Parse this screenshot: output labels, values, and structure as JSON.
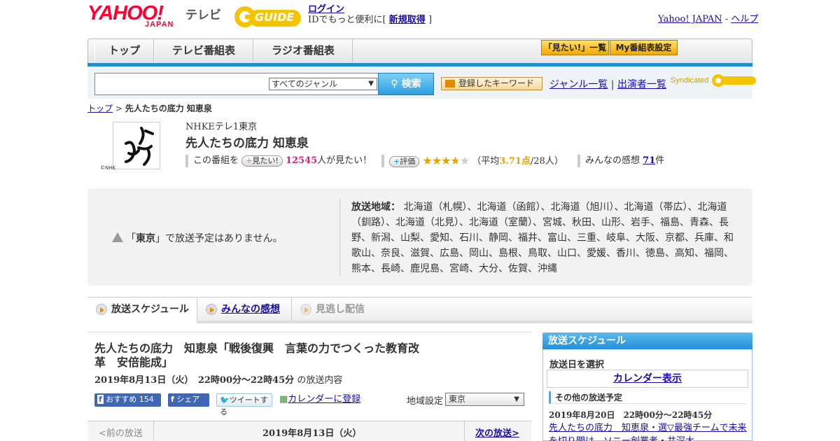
{
  "header": {
    "logo_yahoo": "YAHOO!",
    "logo_japan": "JAPAN",
    "tv_label": "テレビ",
    "gguide_label": "GUIDE",
    "login_link": "ログイン",
    "login_prefix": "IDでもっと便利に[",
    "register_link": "新規取得",
    "login_suffix": "]",
    "yahoo_japan_link": "Yahoo! JAPAN",
    "separator": "-",
    "help_link": "ヘルプ"
  },
  "nav": {
    "tabs": [
      "トップ",
      "テレビ番組表",
      "ラジオ番組表"
    ],
    "want_list_btn": "「見たい!」一覧",
    "my_program_btn": "My番組表設定"
  },
  "search": {
    "genre_select": "すべてのジャンル",
    "search_btn": "検索",
    "keyword_btn": "登録したキーワード",
    "genre_list_link": "ジャンル一覧",
    "pipe": "|",
    "performer_list_link": "出演者一覧",
    "syndicated": "Syndicated"
  },
  "breadcrumb": {
    "top_link": "トップ",
    "sep": ">",
    "current": "先人たちの底力 知恵泉"
  },
  "program": {
    "channel": "NHKEテレ1東京",
    "title": "先人たちの底力 知恵泉",
    "thumb_caption": "©NHK",
    "this_program": "この番組を",
    "want_pill": "見たい!",
    "want_count": "12545",
    "want_suffix": "人が見たい！",
    "rate_pill": "評価",
    "rating_value": 3.71,
    "rating_open": "（平均",
    "rating_text": "3.71点",
    "rating_count": "/28人）",
    "reviews_label": "みんなの感想",
    "reviews_count": "71",
    "reviews_suffix": "件"
  },
  "area": {
    "no_broadcast_pre": "「",
    "no_broadcast_region": "東京",
    "no_broadcast_post": "」で放送予定はありません。",
    "label": "放送地域：",
    "list": "北海道（札幌）、北海道（函館）、北海道（旭川）、北海道（帯広）、北海道（釧路）、北海道（北見）、北海道（室蘭）、宮城、秋田、山形、岩手、福島、青森、長野、新潟、山梨、愛知、石川、静岡、福井、富山、三重、岐阜、大阪、京都、兵庫、和歌山、奈良、滋賀、広島、岡山、島根、鳥取、山口、愛媛、香川、徳島、高知、福岡、熊本、長崎、鹿児島、宮崎、大分、佐賀、沖縄"
  },
  "tabs": {
    "schedule": "放送スケジュール",
    "reviews": "みんなの感想",
    "vod": "見逃し配信"
  },
  "episode": {
    "title": "先人たちの底力　知恵泉「戦後復興　言葉の力でつくった教育改革　安倍能成」",
    "date_bold": "2019年8月13日（火）　22時00分～22時45分",
    "date_suffix": "の放送内容",
    "fb_recommend": "おすすめ",
    "fb_count": "154",
    "fb_share": "シェア",
    "tweet": "ツイートする",
    "calendar_register": "カレンダーに登録",
    "region_label": "地域設定",
    "region_value": "東京",
    "prev": "<前の放送",
    "nav_date": "2019年8月13日（火）",
    "next": "次の放送>"
  },
  "sidebar": {
    "title": "放送スケジュール",
    "select_day": "放送日を選択",
    "calendar_btn": "カレンダー表示",
    "other_head": "その他の放送予定",
    "other_date": "2019年8月20日　22時00分～22時45分",
    "other_link": "先人たちの底力　知恵泉・選▽最強チームで未来を切り開け　ソニー創業者・井深大"
  },
  "colors": {
    "accent_blue": "#1d8fd6",
    "want_count": "#d6246e",
    "rating": "#e8a200"
  }
}
